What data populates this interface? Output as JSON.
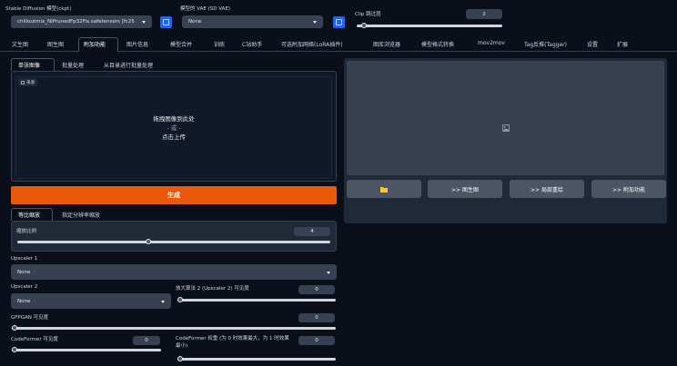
{
  "model": {
    "label": "Stable Diffusion 模型(ckpt)",
    "value": "chilloutmix_NiPrunedFp32Fix.safetensors [fc25"
  },
  "vae": {
    "label": "模型的 VAE (SD VAE)",
    "value": "None"
  },
  "clip": {
    "label": "Clip 跳过层",
    "value": "2",
    "level": 0.05
  },
  "tabs": [
    "文生图",
    "图生图",
    "附加功能",
    "图片信息",
    "模型合并",
    "训练",
    "C站助手",
    "可选附加网络(LoRA插件)",
    "图库浏览器",
    "模型格式转换",
    "mov2mov",
    "Tag反推(Tagger)",
    "设置",
    "扩展"
  ],
  "active_tab": "附加功能",
  "subtabs": [
    "单张图像",
    "批量处理",
    "从目录进行批量处理"
  ],
  "upload": {
    "source_label": "来源",
    "line1": "拖拽图像到此处",
    "line2": "- 或 -",
    "line3": "点击上传"
  },
  "generate_label": "生成",
  "resize_tabs": [
    "等比缩放",
    "指定分辨率缩放"
  ],
  "scale": {
    "label": "缩放比例",
    "value": "4",
    "level": 0.42
  },
  "upscaler1": {
    "label": "Upscaler 1",
    "value": "None"
  },
  "upscaler2": {
    "label": "Upscaler 2",
    "value": "None"
  },
  "upscaler2_vis": {
    "label": "放大算法 2 (Upscaler 2) 可见度",
    "value": "0",
    "level": 0
  },
  "gfpgan": {
    "label": "GFPGAN 可见度",
    "value": "0",
    "level": 0
  },
  "codeformer": {
    "label": "CodeFormer 可见度",
    "value": "0",
    "level": 0
  },
  "codeformer_weight": {
    "label": "CodeFormer 权重 (为 0 时效果最大，为 1 时效果最小)",
    "value": "0",
    "level": 0
  },
  "output_buttons": {
    "folder": "folder-icon",
    "to_img2img": ">> 图生图",
    "to_inpaint": ">> 局部重绘",
    "to_extras": ">> 附加功能"
  },
  "colors": {
    "accent": "#f97316",
    "blue": "#2563eb",
    "bg": "#0b0f19"
  }
}
